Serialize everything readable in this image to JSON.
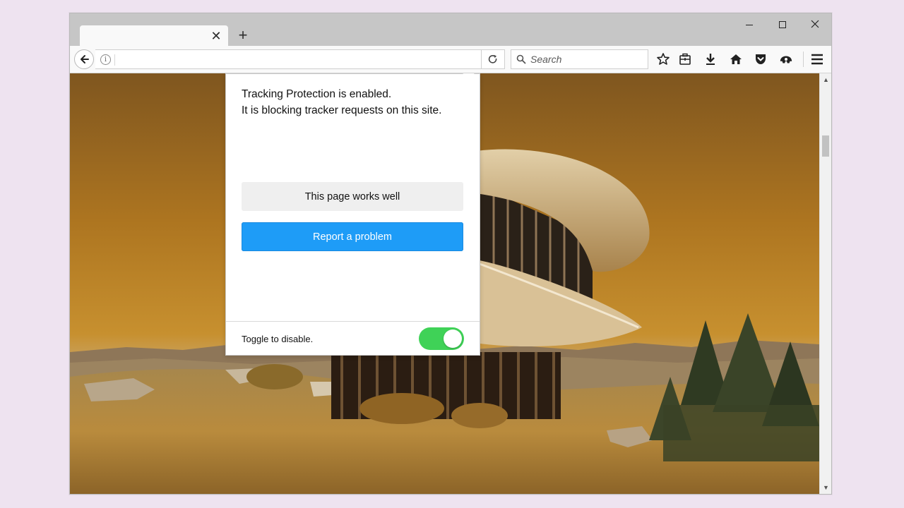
{
  "browser": {
    "tab": {
      "title": "",
      "close_glyph": "✕"
    },
    "new_tab_glyph": "+",
    "url": "",
    "search_placeholder": "Search",
    "toolbar_icons": [
      "bookmark-star-icon",
      "library-icon",
      "download-icon",
      "home-icon",
      "pocket-icon",
      "extension-icon",
      "menu-icon"
    ]
  },
  "popup": {
    "message_line1": "Tracking Protection is enabled.",
    "message_line2": "It is blocking tracker requests on this site.",
    "works_label": "This page works well",
    "report_label": "Report a problem",
    "toggle_label": "Toggle to disable.",
    "toggle_on": true
  },
  "colors": {
    "accent_blue": "#1e9cf7",
    "toggle_green": "#3fd257",
    "shield_purple": "#8a3fa7"
  }
}
